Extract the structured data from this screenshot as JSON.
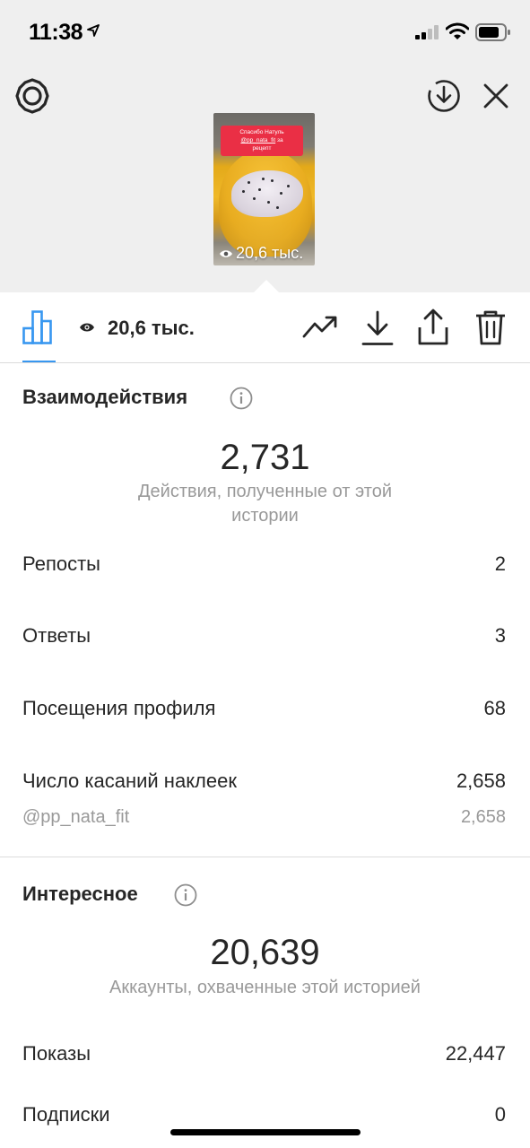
{
  "status_bar": {
    "time": "11:38"
  },
  "story_preview": {
    "sticker_line1": "Спасибо Натуль",
    "sticker_handle": "@pp_nata_fit",
    "sticker_line2": " за",
    "sticker_line3": "рецепт",
    "views_label": "20,6 тыс."
  },
  "toolbar": {
    "views_count": "20,6 тыс."
  },
  "interactions": {
    "title": "Взаимодействия",
    "total": "2,731",
    "total_desc": "Действия, полученные от этой истории",
    "rows": [
      {
        "label": "Репосты",
        "value": "2"
      },
      {
        "label": "Ответы",
        "value": "3"
      },
      {
        "label": "Посещения профиля",
        "value": "68"
      },
      {
        "label": "Число касаний наклеек",
        "value": "2,658"
      }
    ],
    "sticker_sub": {
      "label": "@pp_nata_fit",
      "value": "2,658"
    }
  },
  "discovery": {
    "title": "Интересное",
    "total": "20,639",
    "total_desc": "Аккаунты, охваченные этой историей",
    "rows": [
      {
        "label": "Показы",
        "value": "22,447"
      },
      {
        "label": "Подписки",
        "value": "0"
      }
    ]
  },
  "colors": {
    "accent": "#3897f0",
    "top_background": "#efefef",
    "secondary_text": "#999999",
    "sticker_red": "#ea2f45"
  }
}
